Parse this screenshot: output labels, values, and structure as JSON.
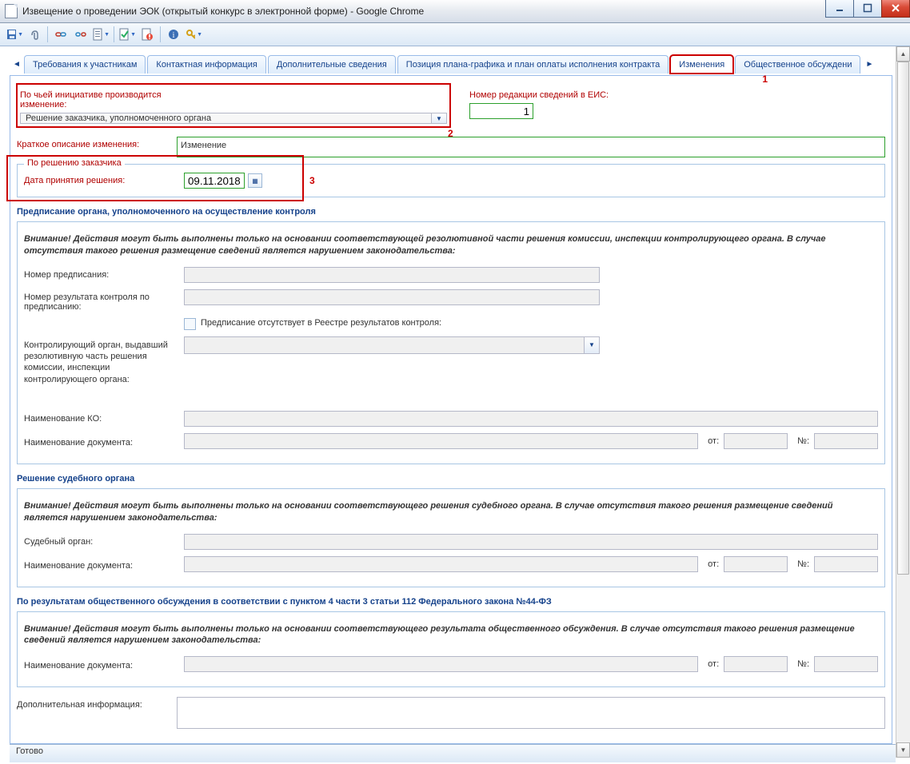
{
  "window": {
    "title": "Извещение о проведении ЭОК (открытый конкурс в электронной форме) - Google Chrome"
  },
  "tabs": [
    "Требования к участникам",
    "Контактная информация",
    "Дополнительные сведения",
    "Позиция плана-графика и план оплаты исполнения контракта",
    "Изменения",
    "Общественное обсуждени"
  ],
  "notes": {
    "n1": "1",
    "n2": "2",
    "n3": "3"
  },
  "top": {
    "initiative_label": "По чьей инициативе производится изменение:",
    "initiative_value": "Решение заказчика, уполномоченного органа",
    "redaction_label": "Номер редакции сведений в ЕИС:",
    "redaction_value": "1",
    "brief_label": "Краткое описание изменения:",
    "brief_value": "Изменение"
  },
  "customer": {
    "legend": "По решению заказчика",
    "date_label": "Дата принятия решения:",
    "date_value": "09.11.2018"
  },
  "control": {
    "title": "Предписание органа, уполномоченного на осуществление контроля",
    "warn": "Внимание! Действия могут быть выполнены только на основании соответствующей резолютивной части решения комиссии, инспекции контролирующего органа. В случае отсутствия такого решения размещение сведений является нарушением законодательства:",
    "num_label": "Номер предписания:",
    "res_label": "Номер результата контроля по предписанию:",
    "chk_label": "Предписание отсутствует в Реестре результатов контроля:",
    "organ_label": "Контролирующий орган, выдавший резолютивную часть решения комиссии, инспекции контролирующего органа:",
    "ko_label": "Наименование КО:",
    "doc_label": "Наименование документа:",
    "ot": "от:",
    "no": "№:"
  },
  "court": {
    "title": "Решение судебного органа",
    "warn": "Внимание! Действия могут быть выполнены только на основании соответствующего решения судебного органа. В случае отсутствия такого решения размещение сведений является нарушением законодательства:",
    "organ_label": "Судебный орган:",
    "doc_label": "Наименование документа:"
  },
  "public": {
    "title": "По результатам общественного обсуждения в соответствии с пунктом 4 части 3 статьи 112 Федерального закона №44-ФЗ",
    "warn": "Внимание! Действия могут быть выполнены только на основании соответствующего результата общественного обсуждения. В случае отсутствия такого решения размещение сведений является нарушением законодательства:",
    "doc_label": "Наименование документа:"
  },
  "extra": {
    "label": "Дополнительная информация:"
  },
  "status": "Готово"
}
